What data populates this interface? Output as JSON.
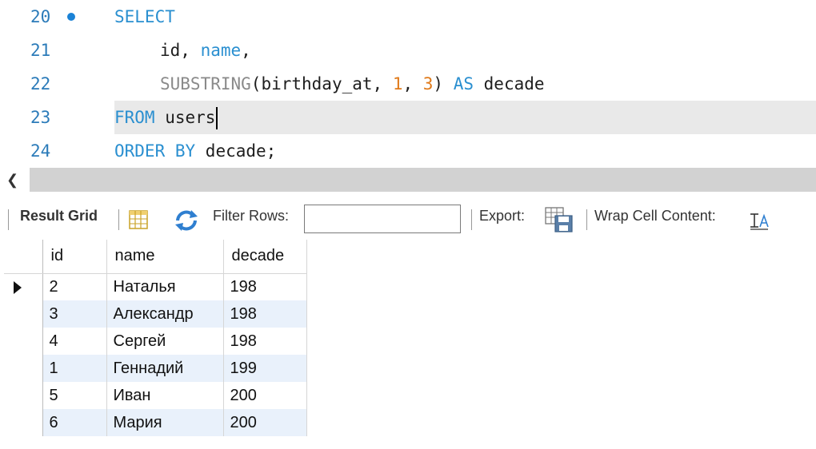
{
  "editor": {
    "lines": [
      {
        "num": "20",
        "tokens": [
          "SELECT"
        ]
      },
      {
        "num": "21",
        "tokens": [
          "id, ",
          "name",
          ","
        ]
      },
      {
        "num": "22",
        "tokens": [
          "SUBSTRING",
          "(birthday_at, ",
          "1",
          ", ",
          "3",
          ") ",
          "AS",
          " decade"
        ]
      },
      {
        "num": "23",
        "tokens": [
          "FROM",
          " users"
        ]
      },
      {
        "num": "24",
        "tokens": [
          "ORDER BY",
          " decade;"
        ]
      }
    ]
  },
  "toolbar": {
    "result_grid_label": "Result Grid",
    "filter_label": "Filter Rows:",
    "filter_value": "",
    "export_label": "Export:",
    "wrap_label": "Wrap Cell Content:"
  },
  "grid": {
    "columns": [
      "id",
      "name",
      "decade"
    ],
    "rows": [
      {
        "id": "2",
        "name": "Наталья",
        "decade": "198"
      },
      {
        "id": "3",
        "name": "Александр",
        "decade": "198"
      },
      {
        "id": "4",
        "name": "Сергей",
        "decade": "198"
      },
      {
        "id": "1",
        "name": "Геннадий",
        "decade": "199"
      },
      {
        "id": "5",
        "name": "Иван",
        "decade": "200"
      },
      {
        "id": "6",
        "name": "Мария",
        "decade": "200"
      }
    ]
  },
  "icons": {
    "breakpoint": "breakpoint-dot-icon",
    "scroll_left": "chevron-left-icon",
    "grid_view": "grid-view-icon",
    "refresh": "refresh-icon",
    "export": "export-icon",
    "wrap": "wrap-text-icon",
    "row_selected": "row-selected-arrow-icon"
  },
  "colors": {
    "keyword": "#2a8fd0",
    "function": "#8a8a8a",
    "number": "#e07a1a",
    "line_number": "#2b7bb9",
    "alt_row": "#e9f1fb",
    "current_line": "#e9e9e9"
  }
}
